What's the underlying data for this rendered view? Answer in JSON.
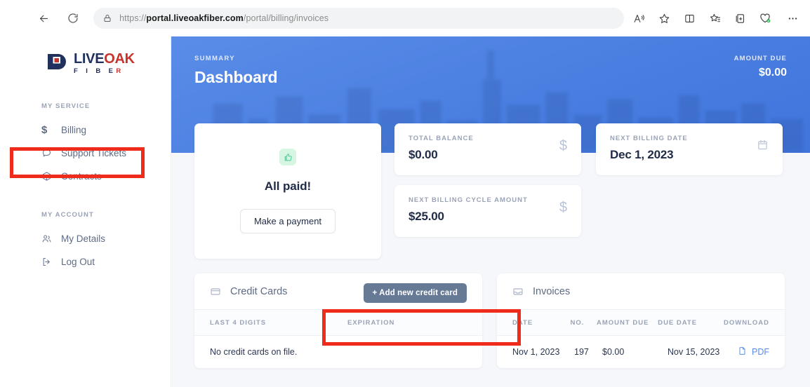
{
  "browser": {
    "url_prefix": "https://",
    "url_bold": "portal.liveoakfiber.com",
    "url_suffix": "/portal/billing/invoices",
    "back_icon": "back-arrow-icon",
    "reload_icon": "reload-icon",
    "lock_icon": "lock-icon",
    "icons": [
      {
        "name": "read-aloud-icon",
        "glyph": "A"
      },
      {
        "name": "favorites-star-icon",
        "glyph": "☆"
      },
      {
        "name": "split-screen-icon",
        "glyph": "▯"
      },
      {
        "name": "favorites-list-icon",
        "glyph": "☆"
      },
      {
        "name": "collections-icon",
        "glyph": "⊞"
      },
      {
        "name": "browser-essentials-icon",
        "glyph": "♡"
      },
      {
        "name": "more-options-icon",
        "glyph": "…"
      }
    ]
  },
  "sidebar": {
    "logo": {
      "word1": "LIVE",
      "word2": "OAK",
      "subtitle": "F I B E",
      "subtitle_accent": "R"
    },
    "sections": [
      {
        "label": "MY SERVICE",
        "items": [
          {
            "label": "Billing",
            "icon": "dollar-icon"
          },
          {
            "label": "Support Tickets",
            "icon": "chat-bubble-icon"
          },
          {
            "label": "Contracts",
            "icon": "box-icon"
          }
        ]
      },
      {
        "label": "MY ACCOUNT",
        "items": [
          {
            "label": "My Details",
            "icon": "people-icon"
          },
          {
            "label": "Log Out",
            "icon": "logout-icon"
          }
        ]
      }
    ]
  },
  "hero": {
    "kicker": "SUMMARY",
    "title": "Dashboard",
    "amount_due_label": "AMOUNT DUE",
    "amount_due_value": "$0.00"
  },
  "all_paid_card": {
    "icon": "thumbs-up-icon",
    "title": "All paid!",
    "button_label": "Make a payment"
  },
  "stats": [
    {
      "label": "TOTAL BALANCE",
      "value": "$0.00",
      "icon": "dollar-icon",
      "glyph": "$"
    },
    {
      "label": "NEXT BILLING DATE",
      "value": "Dec 1, 2023",
      "icon": "calendar-icon",
      "glyph": ""
    },
    {
      "label": "NEXT BILLING CYCLE AMOUNT",
      "value": "$25.00",
      "icon": "dollar-icon",
      "glyph": "$"
    }
  ],
  "credit_cards_panel": {
    "icon": "credit-card-icon",
    "title": "Credit Cards",
    "add_button_label": "+ Add new credit card",
    "columns": [
      "LAST 4 DIGITS",
      "EXPIRATION"
    ],
    "empty_message": "No credit cards on file."
  },
  "invoices_panel": {
    "icon": "inbox-icon",
    "title": "Invoices",
    "columns": [
      "DATE",
      "NO.",
      "AMOUNT DUE",
      "DUE DATE",
      "DOWNLOAD"
    ],
    "rows": [
      {
        "date": "Nov 1, 2023",
        "no": "197",
        "amount_due": "$0.00",
        "due_date": "Nov 15, 2023",
        "download_label": "PDF",
        "download_icon": "pdf-document-icon"
      }
    ]
  },
  "annotations": [
    {
      "name": "billing-highlight",
      "color": "#ef2b1c"
    },
    {
      "name": "add-credit-card-highlight",
      "color": "#ef2b1c"
    }
  ]
}
